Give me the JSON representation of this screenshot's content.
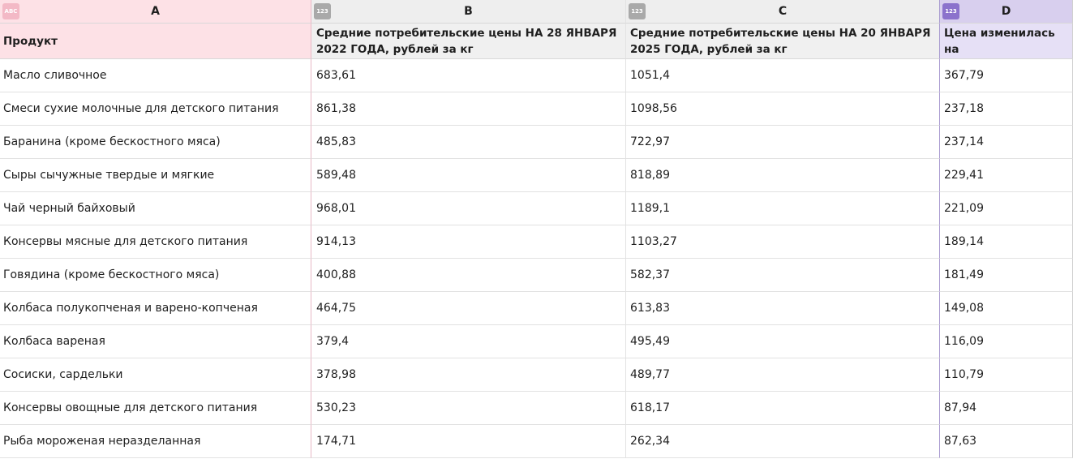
{
  "columns": [
    {
      "letter": "A",
      "badge": "ABC",
      "title": "Продукт"
    },
    {
      "letter": "B",
      "badge": "123",
      "title": "Средние потребительские цены НА 28 ЯНВАРЯ 2022 ГОДА, рублей за кг"
    },
    {
      "letter": "C",
      "badge": "123",
      "title": "Средние потребительские цены НА 20 ЯНВАРЯ 2025 ГОДА, рублей за кг"
    },
    {
      "letter": "D",
      "badge": "123",
      "title": "Цена изменилась на"
    }
  ],
  "rows": [
    [
      "Масло сливочное",
      "683,61",
      "1051,4",
      "367,79"
    ],
    [
      "Смеси сухие молочные для детского питания",
      "861,38",
      "1098,56",
      "237,18"
    ],
    [
      "Баранина (кроме бескостного мяса)",
      "485,83",
      "722,97",
      "237,14"
    ],
    [
      "Сыры сычужные твердые и мягкие",
      "589,48",
      "818,89",
      "229,41"
    ],
    [
      "Чай черный байховый",
      "968,01",
      "1189,1",
      "221,09"
    ],
    [
      "Консервы мясные для детского питания",
      "914,13",
      "1103,27",
      "189,14"
    ],
    [
      "Говядина (кроме бескостного мяса)",
      "400,88",
      "582,37",
      "181,49"
    ],
    [
      "Колбаса полукопченая и варено-копченая",
      "464,75",
      "613,83",
      "149,08"
    ],
    [
      "Колбаса вареная",
      "379,4",
      "495,49",
      "116,09"
    ],
    [
      "Сосиски, сардельки",
      "378,98",
      "489,77",
      "110,79"
    ],
    [
      "Консервы овощные для детского питания",
      "530,23",
      "618,17",
      "87,94"
    ],
    [
      "Рыба мороженая неразделанная",
      "174,71",
      "262,34",
      "87,63"
    ]
  ]
}
